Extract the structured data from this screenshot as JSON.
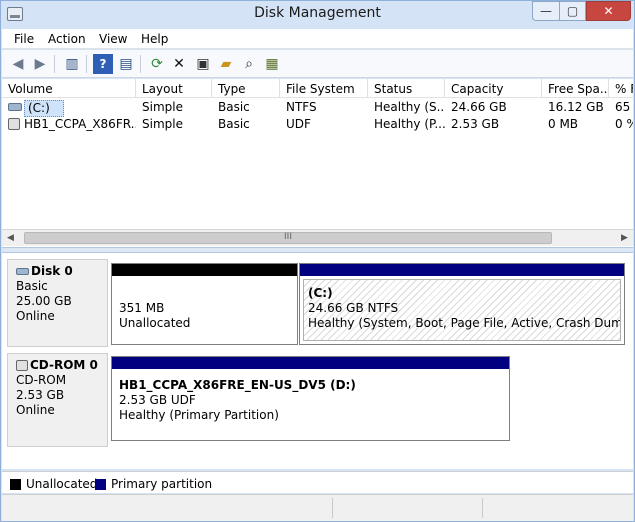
{
  "window": {
    "title": "Disk Management",
    "controls": {
      "minimize": "—",
      "maximize": "▢",
      "close": "✕"
    }
  },
  "menu": [
    "File",
    "Action",
    "View",
    "Help"
  ],
  "toolbar": [
    {
      "icon": "back-arrow-icon",
      "glyph": "◀"
    },
    {
      "icon": "forward-arrow-icon",
      "glyph": "▶"
    },
    {
      "icon": "console-tree-icon",
      "glyph": "▥"
    },
    {
      "icon": "help-icon",
      "glyph": "?"
    },
    {
      "icon": "properties-icon",
      "glyph": "▤"
    },
    {
      "icon": "refresh-icon",
      "glyph": "⟳"
    },
    {
      "icon": "delete-icon",
      "glyph": "✕"
    },
    {
      "icon": "volume-properties-icon",
      "glyph": "▣"
    },
    {
      "icon": "open-folder-icon",
      "glyph": "▰"
    },
    {
      "icon": "explore-icon",
      "glyph": "⌕"
    },
    {
      "icon": "disk-settings-icon",
      "glyph": "▦"
    }
  ],
  "columns": [
    "Volume",
    "Layout",
    "Type",
    "File System",
    "Status",
    "Capacity",
    "Free Spa...",
    "% F"
  ],
  "volumes": [
    {
      "icon": "hard-drive-icon",
      "cells": [
        "(C:)",
        "Simple",
        "Basic",
        "NTFS",
        "Healthy (S...",
        "24.66 GB",
        "16.12 GB",
        "65"
      ]
    },
    {
      "icon": "cdrom-drive-icon",
      "cells": [
        "HB1_CCPA_X86FR...",
        "Simple",
        "Basic",
        "UDF",
        "Healthy (P...",
        "2.53 GB",
        "0 MB",
        "0 %"
      ]
    }
  ],
  "scroll_thumb_glyph": "III",
  "disks": [
    {
      "name": "Disk 0",
      "kind": "Basic",
      "size": "25.00 GB",
      "state": "Online",
      "partitions": [
        {
          "title": "",
          "line1": "351 MB",
          "line2": "Unallocated",
          "bar_color": "#000000"
        },
        {
          "title": "(C:)",
          "line1": "24.66 GB NTFS",
          "line2": "Healthy (System, Boot, Page File, Active, Crash Dump, Prim",
          "bar_color": "#000080"
        }
      ]
    },
    {
      "name": "CD-ROM 0",
      "kind": "CD-ROM",
      "size": "2.53 GB",
      "state": "Online",
      "partitions": [
        {
          "title": "HB1_CCPA_X86FRE_EN-US_DV5  (D:)",
          "line1": "2.53 GB UDF",
          "line2": "Healthy (Primary Partition)",
          "bar_color": "#000080"
        }
      ]
    }
  ],
  "legend": [
    {
      "label": "Unallocated",
      "color": "#000000"
    },
    {
      "label": "Primary partition",
      "color": "#000080"
    }
  ]
}
